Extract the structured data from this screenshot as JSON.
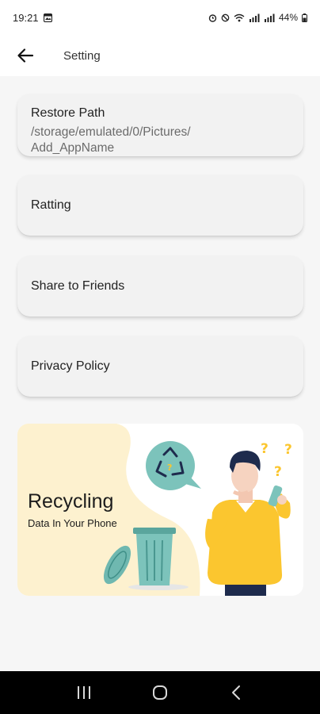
{
  "status_bar": {
    "time": "19:21",
    "battery": "44%"
  },
  "app_bar": {
    "title": "Setting",
    "back_icon": "arrow-back-icon"
  },
  "settings": {
    "restore_path": {
      "title": "Restore Path",
      "path_line1": "/storage/emulated/0/Pictures/",
      "path_line2": "Add_AppName"
    },
    "rating": {
      "title": "Ratting"
    },
    "share": {
      "title": "Share to Friends"
    },
    "privacy": {
      "title": "Privacy Policy"
    }
  },
  "banner": {
    "title": "Recycling",
    "subtitle": "Data In Your Phone",
    "colors": {
      "cream": "#fdf1cf",
      "teal": "#7cc3bb",
      "yellow": "#fbc62f",
      "navy": "#1e2b4d"
    }
  },
  "nav_bar": {
    "icons": [
      "recent-apps-icon",
      "home-icon",
      "back-icon"
    ]
  }
}
